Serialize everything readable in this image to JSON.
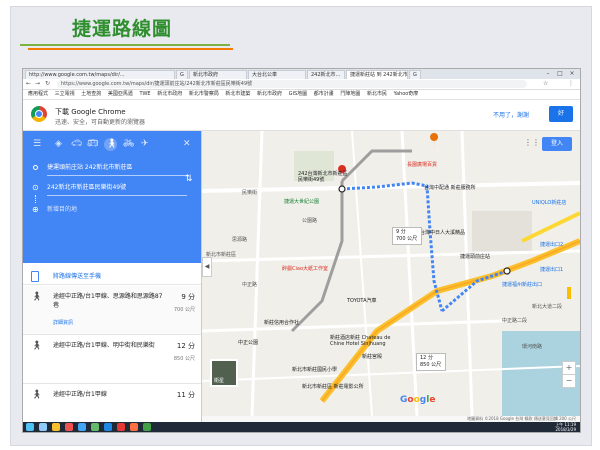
{
  "slide": {
    "title": "捷運路線圖"
  },
  "browser": {
    "tabs": [
      {
        "label": "http://www.google.com.tw/maps/dir/...",
        "active": false
      },
      {
        "label": "G",
        "active": false
      },
      {
        "label": "新北市政府",
        "active": false
      },
      {
        "label": "大台北公車",
        "active": false
      },
      {
        "label": "242新北市...",
        "active": false
      },
      {
        "label": "捷運新莊站 到 242新北市 ...",
        "active": true
      },
      {
        "label": "G",
        "active": false
      }
    ],
    "url": "https://www.google.com.tw/maps/dir/捷運頭前庄站/242新北市新莊區民樂街49號",
    "bookmarks": [
      "應用程式",
      "三立電視",
      "土地查詢",
      "美國亞馬遜",
      "TWE",
      "新北市政府",
      "新北市警察局",
      "新北市建築",
      "新北市政府",
      "GIS地圖",
      "都市計畫",
      "鬥陣地圖",
      "新北市民",
      "Yahoo奇摩"
    ]
  },
  "promo": {
    "title": "下載 Google Chrome",
    "subtitle": "迅速、安全，可自動更新的瀏覽器",
    "decline": "不用了，謝謝",
    "accept": "好"
  },
  "directions": {
    "from": "捷運頭前庄站 242新北市新莊區",
    "to": "242新北市新莊區民樂街49號",
    "add_destination": "新增目的地",
    "send_to_phone": "將路線傳送至手機",
    "routes": [
      {
        "name": "途經中正路/台1甲線、思源路和思源路87巷",
        "time": "9 分",
        "distance": "700 公尺",
        "detail": "詳細資訊"
      },
      {
        "name": "途經中正路/台1甲線、明中街和民樂街",
        "time": "12 分",
        "distance": "850 公尺",
        "detail": ""
      },
      {
        "name": "途經中正路/台1甲線",
        "time": "11 分",
        "distance": "",
        "detail": ""
      }
    ]
  },
  "map": {
    "login": "登入",
    "destination_label": "242台灣新北市新莊區民樂街49號",
    "origin_label": "捷運頭前庄站",
    "callout_fast": {
      "time": "9 分",
      "dist": "700 公尺"
    },
    "callout_alt": {
      "time": "12 分",
      "dist": "850 公尺"
    },
    "labels": {
      "shop": "長園廣場百貨",
      "car": "台灣中配通 新莊服務所",
      "park": "捷運大世紀公園",
      "school": "新莊國民中學",
      "tech": "台灣中日人大溪精品",
      "uniqlo": "UNIQLO新莊店",
      "exit2": "捷運出口2",
      "exit1": "捷運出口1",
      "fuzhou": "捷運福州新莊出口",
      "toyota": "TOYOTA汽車",
      "bank": "新莊信用合作社",
      "hotel": "新莊酒店新莊 Chateau de Chine Hotel Sinjhuang",
      "mall": "新莊宮殿",
      "junior": "新北市新莊國民小學",
      "cloud": "醉戲Ciao大紙工作室",
      "cinema": "新北市新莊區 新莊電影公所",
      "zhongzheng": "中正公園",
      "road1": "思源路",
      "road2": "中正路",
      "road3": "公園路",
      "road4": "新北市新莊區",
      "road5": "新北大道二段",
      "road6": "民樂街",
      "road7": "中正路二段",
      "road8": "環河南路"
    },
    "footer": "地圖資料 ©2018 Google 台灣 條款 傳送意見回饋 200 公尺"
  },
  "taskbar": {
    "time": "上午 11:19",
    "date": "2018/3/29",
    "zoom": "150%"
  }
}
